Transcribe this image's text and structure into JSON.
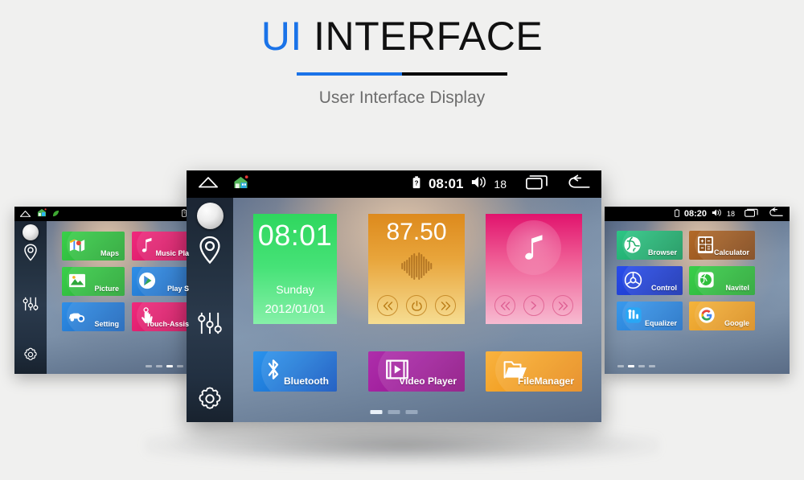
{
  "header": {
    "title_highlight": "UI",
    "title_rest": " INTERFACE",
    "subtitle": "User Interface Display",
    "accent_color": "#1a73e8",
    "title_color": "#111111",
    "subtitle_color": "#6d6d6d",
    "background_color": "#f0f0ef"
  },
  "left_device": {
    "statusbar": {
      "home_icon": "home-outline-icon",
      "app_icon": "house-app-icon",
      "notification_icon": "notification-leaf-icon",
      "battery_icon": "battery-icon"
    },
    "sidebar": {
      "knob": "rotary-knob",
      "items": [
        {
          "icon": "location-pin-icon",
          "name": "navigation"
        },
        {
          "icon": "equalizer-sliders-icon",
          "name": "equalizer"
        },
        {
          "icon": "gear-icon",
          "name": "settings"
        }
      ]
    },
    "apps": [
      {
        "label": "Maps",
        "icon": "maps-icon",
        "color": "#2fbf3c",
        "color2": "#27a434"
      },
      {
        "label": "Music Pla",
        "icon": "music-note-icon",
        "color": "#e6186b",
        "color2": "#c8115a"
      },
      {
        "label": "Picture",
        "icon": "picture-icon",
        "color": "#2fbf3c",
        "color2": "#27a434"
      },
      {
        "label": "Play S",
        "icon": "play-store-icon",
        "color": "#2176d6",
        "color2": "#1b63b8"
      },
      {
        "label": "Setting",
        "icon": "car-setting-icon",
        "color": "#2176d6",
        "color2": "#1b63b8"
      },
      {
        "label": "Touch-Assis",
        "icon": "touch-assistant-icon",
        "color": "#e6186b",
        "color2": "#c8115a"
      }
    ],
    "page_dots": {
      "count": 4,
      "active_index": 2
    }
  },
  "center_device": {
    "statusbar": {
      "home_icon": "home-outline-icon",
      "app_icon": "house-app-icon",
      "battery_icon": "battery-icon",
      "time": "08:01",
      "volume_icon": "speaker-icon",
      "volume": "18",
      "recents_icon": "recents-icon",
      "back_icon": "back-arrow-icon"
    },
    "sidebar": {
      "knob": "rotary-knob",
      "items": [
        {
          "icon": "location-pin-icon",
          "name": "navigation"
        },
        {
          "icon": "equalizer-sliders-icon",
          "name": "equalizer"
        },
        {
          "icon": "gear-icon",
          "name": "settings"
        }
      ]
    },
    "clock_tile": {
      "time": "08:01",
      "weekday": "Sunday",
      "date": "2012/01/01",
      "color": "#3ee06a",
      "color2": "#7bf0a0"
    },
    "radio_tile": {
      "frequency": "87.50",
      "color": "#e08a20",
      "color2": "#f7dd93",
      "controls": [
        {
          "icon": "prev-icon"
        },
        {
          "icon": "power-icon"
        },
        {
          "icon": "next-icon"
        }
      ]
    },
    "music_tile": {
      "icon": "music-note-icon",
      "color": "#e6146f",
      "color2": "#f7b6ce",
      "controls": [
        {
          "icon": "prev-icon"
        },
        {
          "icon": "play-icon"
        },
        {
          "icon": "next-icon"
        }
      ]
    },
    "dock": [
      {
        "label": "Bluetooth",
        "icon": "bluetooth-icon",
        "color": "#1f86e8",
        "color2": "#0f55c0"
      },
      {
        "label": "Video Player",
        "icon": "video-player-icon",
        "color": "#b52db0",
        "color2": "#8d1182"
      },
      {
        "label": "FileManager",
        "icon": "folder-icon",
        "color": "#f5a623",
        "color2": "#e1871a"
      }
    ],
    "page_dots": {
      "count": 3,
      "active_index": 0
    }
  },
  "right_device": {
    "statusbar": {
      "battery_icon": "battery-icon",
      "time": "08:20",
      "volume_icon": "speaker-icon",
      "volume": "18",
      "recents_icon": "recents-icon",
      "back_icon": "back-arrow-icon"
    },
    "apps": [
      {
        "label": "Browser",
        "icon": "globe-icon",
        "color": "#1fae6a",
        "color2": "#17945a"
      },
      {
        "label": "Calculator",
        "icon": "calculator-icon",
        "color": "#9b5a22",
        "color2": "#7d4418"
      },
      {
        "label": "Control",
        "icon": "steering-wheel-icon",
        "color": "#1f3fd6",
        "color2": "#1630af"
      },
      {
        "label": "Navitel",
        "icon": "navitel-icon",
        "color": "#2fbf3c",
        "color2": "#27a434"
      },
      {
        "label": "Equalizer",
        "icon": "equalizer-icon",
        "color": "#2b8fe8",
        "color2": "#1f6fc4"
      },
      {
        "label": "Google",
        "icon": "google-icon",
        "color": "#f0a32c",
        "color2": "#d98b1c"
      }
    ],
    "page_dots": {
      "count": 4,
      "active_index": 1
    }
  }
}
